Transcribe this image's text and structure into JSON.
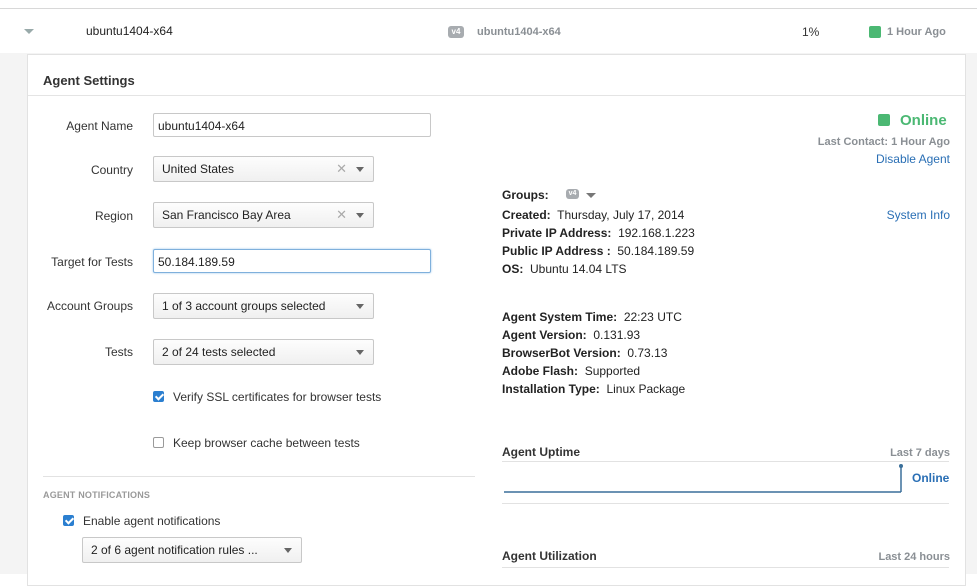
{
  "agent_row": {
    "name": "ubuntu1404-x64",
    "badge": "v4",
    "hostname": "ubuntu1404-x64",
    "utilization": "1%",
    "last_seen": "1 Hour Ago"
  },
  "panel": {
    "title": "Agent Settings",
    "fields": {
      "agent_name_label": "Agent Name",
      "agent_name_value": "ubuntu1404-x64",
      "country_label": "Country",
      "country_value": "United States",
      "region_label": "Region",
      "region_value": "San Francisco Bay Area",
      "target_label": "Target for Tests",
      "target_value": "50.184.189.59",
      "account_groups_label": "Account Groups",
      "account_groups_value": "1 of 3 account groups selected",
      "tests_label": "Tests",
      "tests_value": "2 of 24 tests selected",
      "verify_ssl_label": "Verify SSL certificates for browser tests",
      "keep_cache_label": "Keep browser cache between tests"
    },
    "notifications": {
      "section_label": "AGENT NOTIFICATIONS",
      "enable_label": "Enable agent notifications",
      "rules_value": "2 of 6 agent notification rules ..."
    },
    "status": {
      "state": "Online",
      "last_contact": "Last Contact: 1 Hour Ago",
      "disable_link": "Disable Agent",
      "system_info_link": "System Info"
    },
    "info": {
      "groups_label": "Groups:",
      "groups_badge": "v4",
      "created_label": "Created:",
      "created_value": "Thursday, July 17, 2014",
      "private_ip_label": "Private IP Address:",
      "private_ip_value": "192.168.1.223",
      "public_ip_label": "Public IP Address :",
      "public_ip_value": "50.184.189.59",
      "os_label": "OS:",
      "os_value": "Ubuntu 14.04 LTS",
      "system_time_label": "Agent System Time:",
      "system_time_value": "22:23 UTC",
      "agent_version_label": "Agent Version:",
      "agent_version_value": "0.131.93",
      "browserbot_label": "BrowserBot Version:",
      "browserbot_value": "0.73.13",
      "flash_label": "Adobe Flash:",
      "flash_value": "Supported",
      "install_label": "Installation Type:",
      "install_value": "Linux Package"
    },
    "uptime": {
      "title": "Agent Uptime",
      "range": "Last 7 days",
      "state": "Online"
    },
    "utilization": {
      "title": "Agent Utilization",
      "range": "Last 24 hours"
    }
  },
  "colors": {
    "online_green": "#4bb873",
    "link_blue": "#2a6fb5",
    "checkbox_blue": "#2b7fd0"
  }
}
